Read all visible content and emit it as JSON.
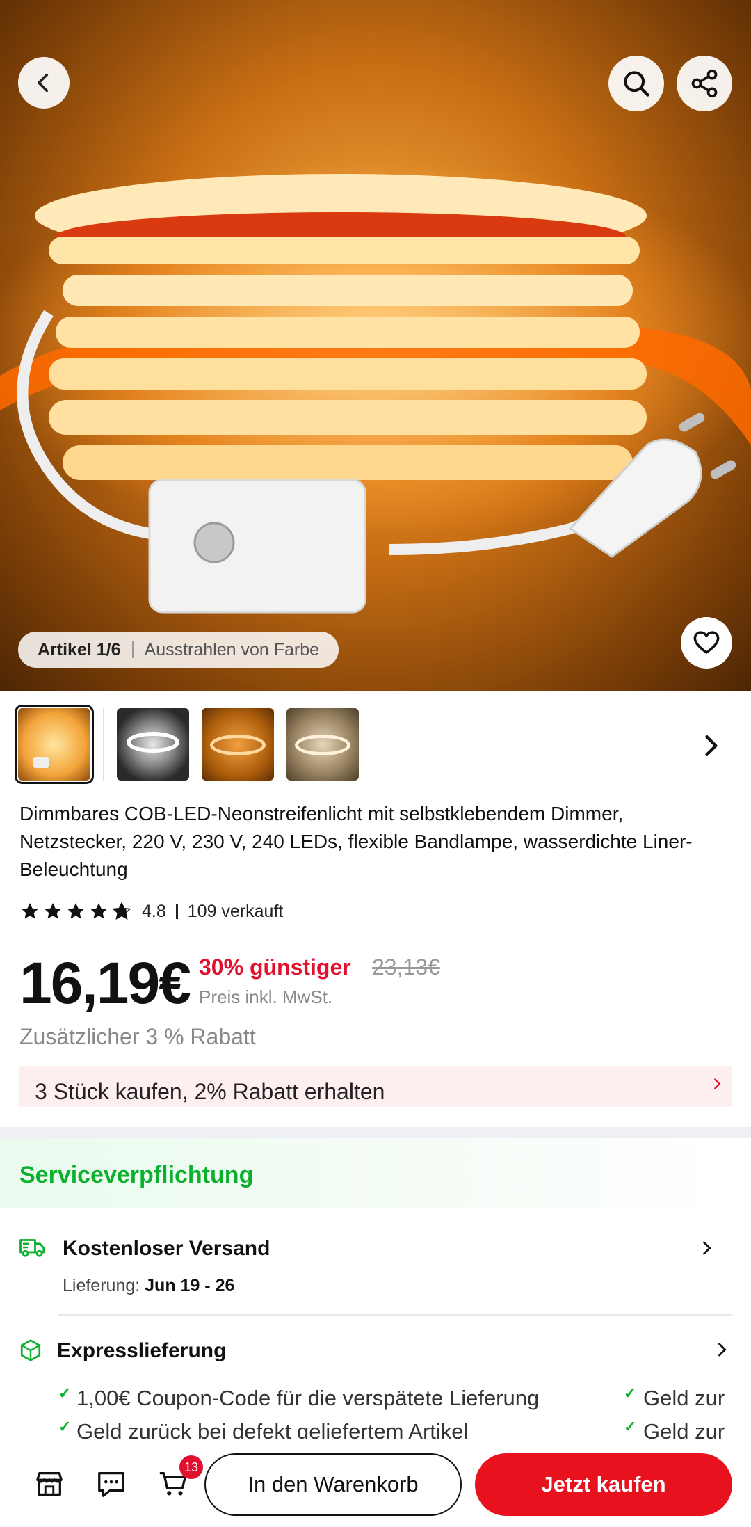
{
  "hero": {
    "counter": "Artikel 1/6",
    "variant": "Ausstrahlen von Farbe"
  },
  "thumbnails": [
    {
      "name": "warm-coil"
    },
    {
      "name": "white-coil-dark"
    },
    {
      "name": "orange-strip"
    },
    {
      "name": "beige-strip"
    }
  ],
  "product": {
    "title": "Dimmbares COB-LED-Neonstreifenlicht mit selbstklebendem Dimmer, Netzstecker, 220 V, 230 V, 240 LEDs, flexible Bandlampe, wasserdichte Liner-Beleuchtung",
    "rating": "4.8",
    "rating_stars": 4.8,
    "sold": "109 verkauft",
    "price": "16,19€",
    "discount": "30% günstiger",
    "original_price": "23,13€",
    "tax_note": "Preis inkl. MwSt.",
    "extra_discount": "Zusätzlicher 3 % Rabatt",
    "promo": "3 Stück kaufen, 2% Rabatt erhalten"
  },
  "service": {
    "heading": "Serviceverpflichtung",
    "shipping_title": "Kostenloser Versand",
    "delivery_label": "Lieferung:",
    "delivery_dates": "Jun 19 - 26",
    "express_title": "Expresslieferung",
    "bullets": [
      "1,00€ Coupon-Code für die verspätete Lieferung",
      "Geld zur",
      "Geld zurück bei defekt geliefertem Artikel",
      "Geld zur"
    ]
  },
  "bottom_bar": {
    "cart_count": "13",
    "add_to_cart": "In den Warenkorb",
    "buy_now": "Jetzt kaufen"
  },
  "colors": {
    "accent_red": "#e8121f",
    "service_green": "#0bb02c",
    "discount_red": "#e0102e"
  }
}
